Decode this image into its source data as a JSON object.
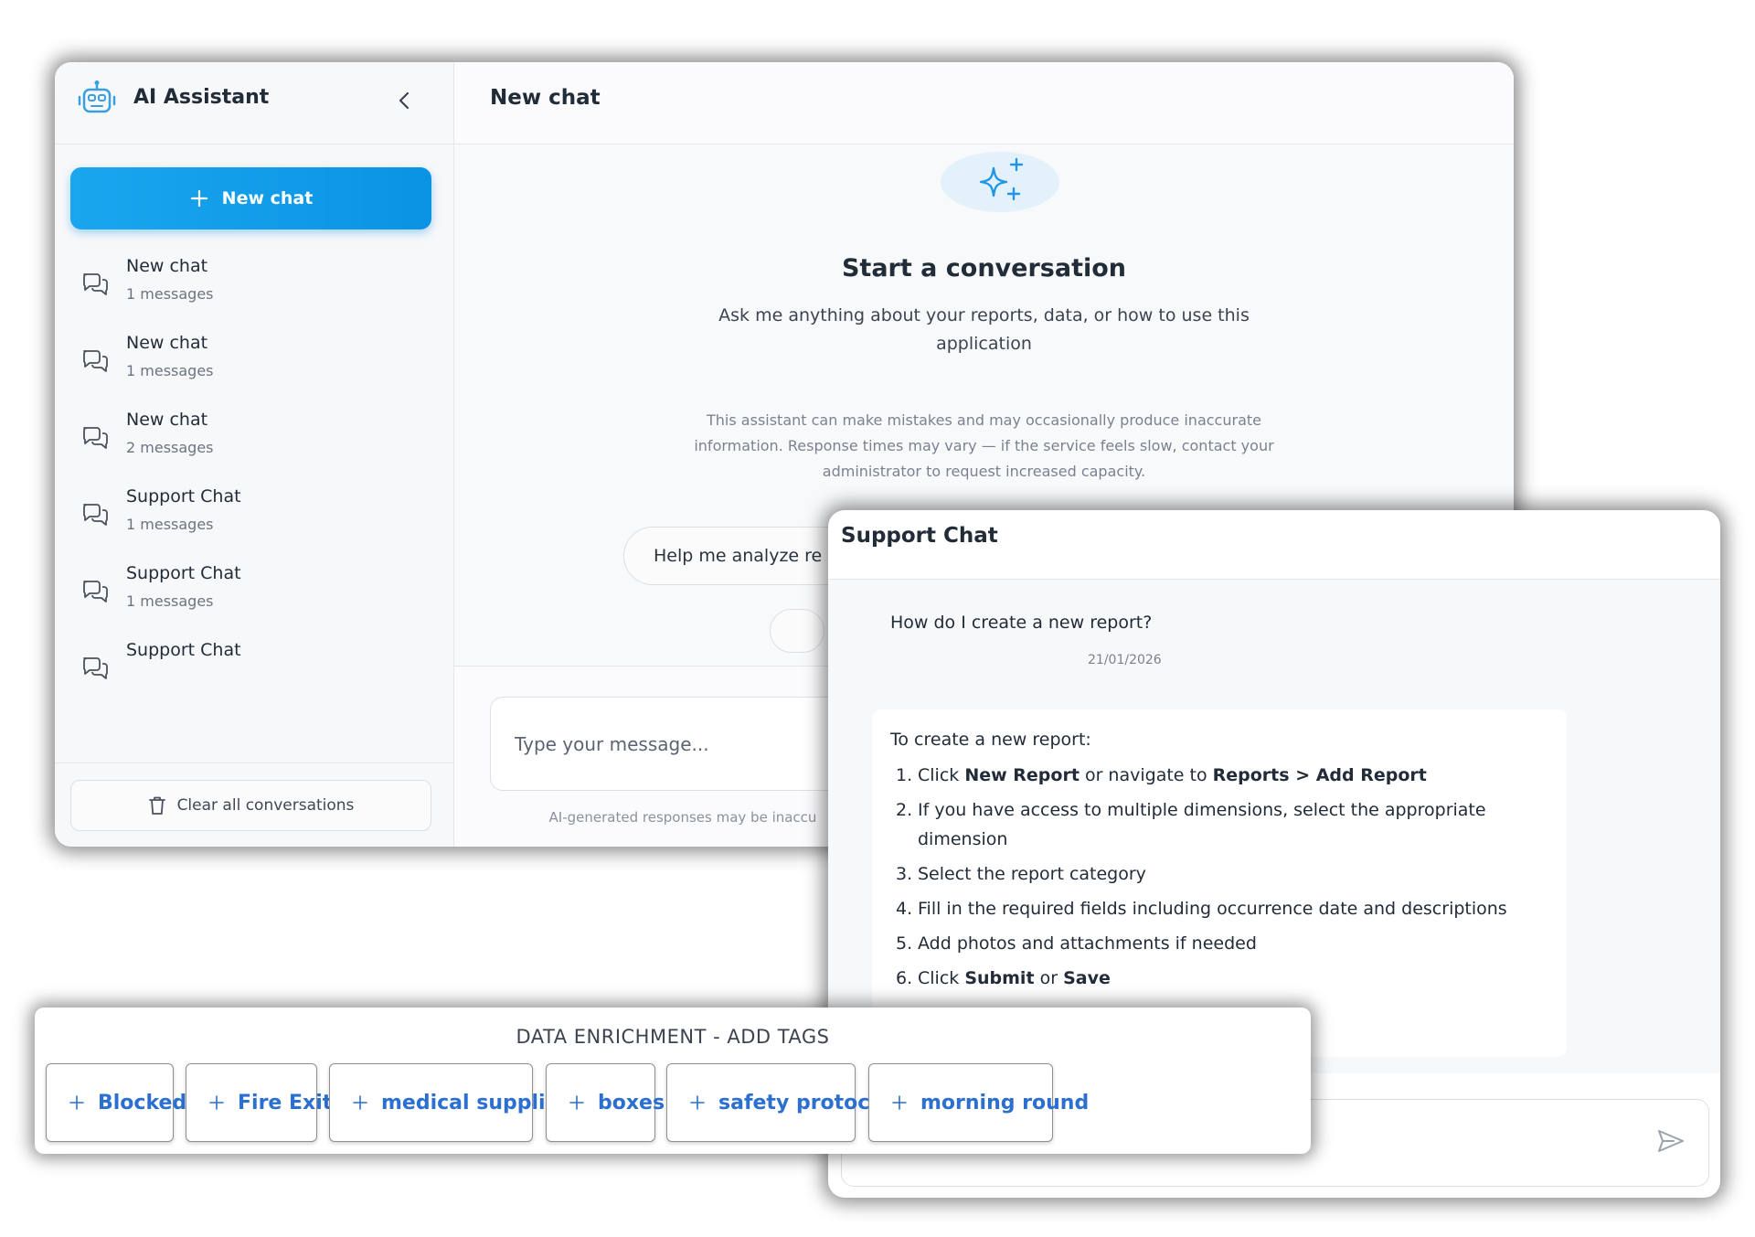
{
  "main_window": {
    "sidebar": {
      "brand": "AI Assistant",
      "new_chat_label": "New chat",
      "conversations": [
        {
          "title": "New chat",
          "count": "1 messages"
        },
        {
          "title": "New chat",
          "count": "1 messages"
        },
        {
          "title": "New chat",
          "count": "2 messages"
        },
        {
          "title": "Support Chat",
          "count": "1 messages"
        },
        {
          "title": "Support Chat",
          "count": "1 messages"
        },
        {
          "title": "Support Chat",
          "count": ""
        }
      ],
      "clear_label": "Clear all conversations"
    },
    "chat": {
      "title": "New chat",
      "empty_title": "Start a conversation",
      "empty_desc": "Ask me anything about your reports, data, or how to use this application",
      "disclaimer": "This assistant can make mistakes and may occasionally produce inaccurate information. Response times may vary — if the service feels slow, contact your administrator to request increased capacity.",
      "suggestion": "Help me analyze re",
      "input_placeholder": "Type your message...",
      "footer_note": "AI-generated responses may be inaccu"
    }
  },
  "support_window": {
    "title": "Support Chat",
    "user_message": "How do I create a new report?",
    "user_message_date": "21/01/2026",
    "assistant_intro": "To create a new report:",
    "steps": [
      {
        "n": "1.",
        "parts": [
          {
            "t": "Click ",
            "b": false
          },
          {
            "t": "New Report",
            "b": true
          },
          {
            "t": " or navigate to ",
            "b": false
          },
          {
            "t": "Reports > Add Report",
            "b": true
          }
        ]
      },
      {
        "n": "2.",
        "parts": [
          {
            "t": "If you have access to multiple dimensions, select the appropriate dimension",
            "b": false
          }
        ]
      },
      {
        "n": "3.",
        "parts": [
          {
            "t": "Select the report category",
            "b": false
          }
        ]
      },
      {
        "n": "4.",
        "parts": [
          {
            "t": "Fill in the required fields including occurrence date and descriptions",
            "b": false
          }
        ]
      },
      {
        "n": "5.",
        "parts": [
          {
            "t": "Add photos and attachments if needed",
            "b": false
          }
        ]
      },
      {
        "n": "6.",
        "parts": [
          {
            "t": "Click ",
            "b": false
          },
          {
            "t": "Submit",
            "b": true
          },
          {
            "t": " or ",
            "b": false
          },
          {
            "t": "Save",
            "b": true
          }
        ]
      }
    ]
  },
  "tag_panel": {
    "title": "DATA ENRICHMENT - ADD TAGS",
    "tags": [
      "Blocked",
      "Fire Exit",
      "medical supplies",
      "boxes",
      "safety protocol",
      "morning round"
    ]
  },
  "colors": {
    "accent": "#1aa6ef",
    "tag_text": "#2b6fd0",
    "icon_blue": "#3a9fe0"
  }
}
